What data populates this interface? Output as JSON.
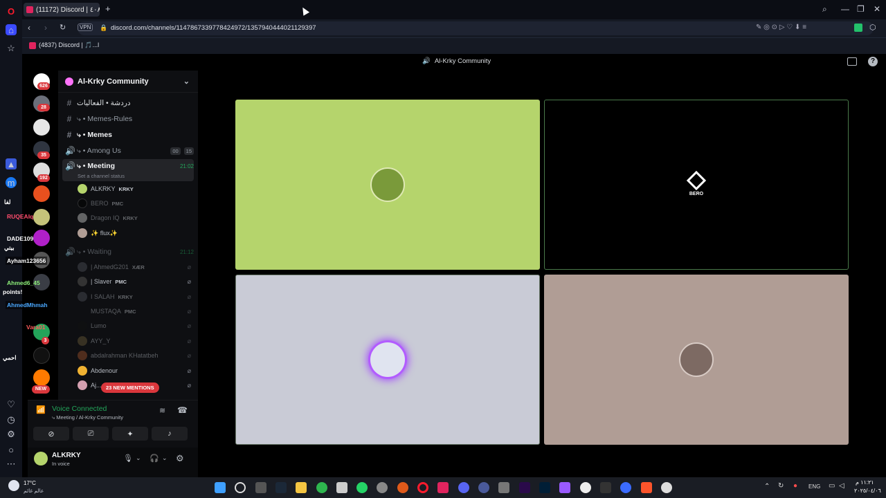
{
  "browser": {
    "tab_title": "(11172) Discord | ٤٠٨",
    "new_tab": "+",
    "url": "discord.com/channels/1147867339778424972/1357940444021129397",
    "vpn": "VPN",
    "bookmark": "(4837) Discord | 🎵...l"
  },
  "discord": {
    "top_title": "Al-Krky Community",
    "guild_badges": [
      "626",
      "28",
      "35",
      "192",
      "3",
      "NEW"
    ],
    "server_name": "Al-Krky Community",
    "channels": [
      {
        "type": "text",
        "name": "دردشة • الفعاليات",
        "bold": false
      },
      {
        "type": "text",
        "name": "⤷ • Memes-Rules",
        "bold": false
      },
      {
        "type": "text",
        "name": "⤷ • Memes",
        "bold": true
      },
      {
        "type": "voice",
        "name": "⤷ • Among Us",
        "bold": false,
        "counter_a": "00",
        "counter_b": "15"
      },
      {
        "type": "voice",
        "name": "⤷ • Meeting",
        "bold": true,
        "time": "21:02",
        "status": "Set a channel status"
      }
    ],
    "meeting_users": [
      {
        "name": "ALKRKY",
        "tag": "KRKY"
      },
      {
        "name": "BERO",
        "tag": "PMC"
      },
      {
        "name": "Dragon IQ",
        "tag": "KRKY"
      },
      {
        "name": "✨ flux✨",
        "tag": ""
      }
    ],
    "waiting_channel": {
      "name": "⤷ • Waiting",
      "time": "21:12"
    },
    "waiting_users": [
      {
        "name": "| AhmedG201",
        "tag": "XÆR"
      },
      {
        "name": "| Slaver",
        "tag": "PMC"
      },
      {
        "name": "I SALAH",
        "tag": "KRKY"
      },
      {
        "name": "MUSTAQA",
        "tag": "PMC"
      },
      {
        "name": "Lumo",
        "tag": ""
      },
      {
        "name": "AYY_Y",
        "tag": ""
      },
      {
        "name": "abdalrahman KHatatbeh",
        "tag": ""
      },
      {
        "name": "Abdenour",
        "tag": ""
      },
      {
        "name": "Aj...",
        "tag": ""
      }
    ],
    "mentions_pill": "23 NEW MENTIONS",
    "voice_connected": "Voice Connected",
    "voice_location": "⤷ Meeting / Al-Krky Community",
    "user": {
      "name": "ALKRKY",
      "status": "In voice"
    },
    "tiles": [
      {
        "label": "",
        "bg": "#b5d46c"
      },
      {
        "label": "BERO",
        "bg": "#000000"
      },
      {
        "label": "",
        "bg": "#c9cbd6"
      },
      {
        "label": "",
        "bg": "#b09d95"
      }
    ]
  },
  "overlay_names": [
    {
      "name": "RUQEAIq",
      "color": "#ff4d6d"
    },
    {
      "name": "DADE109",
      "color": "#ffffff"
    },
    {
      "name": "بيتي",
      "color": "#ffffff"
    },
    {
      "name": "Ayham123656",
      "color": "#ffffff"
    },
    {
      "name": "Ahmed6_45",
      "color": "#8ef07a"
    },
    {
      "name": "points!",
      "color": "#ffffff"
    },
    {
      "name": "AhmedMhmah",
      "color": "#4aa8ff"
    },
    {
      "name": "Vara01",
      "color": "#ff5c5c"
    },
    {
      "name": "احمي",
      "color": "#ffffff"
    },
    {
      "name": "لفا",
      "color": "#ffffff"
    }
  ],
  "taskbar": {
    "weather_temp": "17°C",
    "weather_place": "عالم غائم",
    "lang": "ENG",
    "time": "١١:٢١ م",
    "date": "٢٠٢٥/٠٤/٠٦"
  }
}
